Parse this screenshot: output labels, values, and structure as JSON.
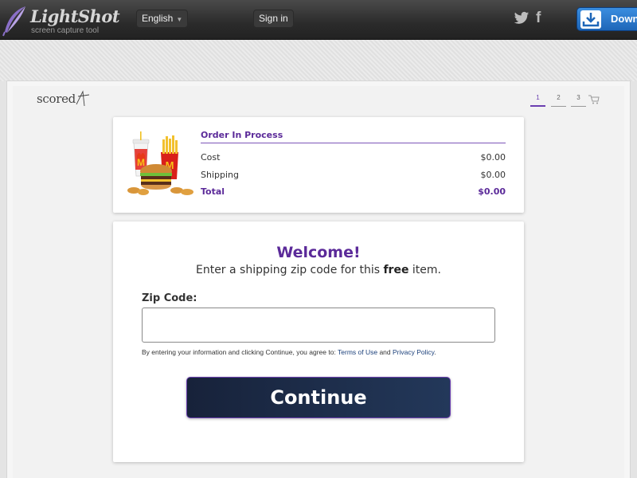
{
  "header": {
    "logo_title": "LightShot",
    "logo_subtitle": "screen capture tool",
    "language": "English",
    "signin_label": "Sign in",
    "social_icons": [
      "twitter-icon",
      "facebook-icon"
    ],
    "download_label": "Down"
  },
  "page": {
    "brand": "scored",
    "steps": [
      "1",
      "2",
      "3"
    ],
    "active_step": "1",
    "accent_color": "#5b2a99"
  },
  "order": {
    "title": "Order In Process",
    "rows": [
      {
        "label": "Cost",
        "amount": "$0.00"
      },
      {
        "label": "Shipping",
        "amount": "$0.00"
      },
      {
        "label": "Total",
        "amount": "$0.00"
      }
    ]
  },
  "welcome": {
    "title": "Welcome!",
    "subtitle_pre": "Enter a shipping zip code for this ",
    "subtitle_bold": "free",
    "subtitle_post": " item.",
    "zip_label": "Zip Code:",
    "zip_value": "",
    "legal_pre": "By entering your information and clicking Continue, you agree to: ",
    "terms_link": "Terms of Use",
    "legal_and": " and ",
    "privacy_link": "Privacy Policy",
    "legal_post": ".",
    "continue_label": "Continue"
  }
}
